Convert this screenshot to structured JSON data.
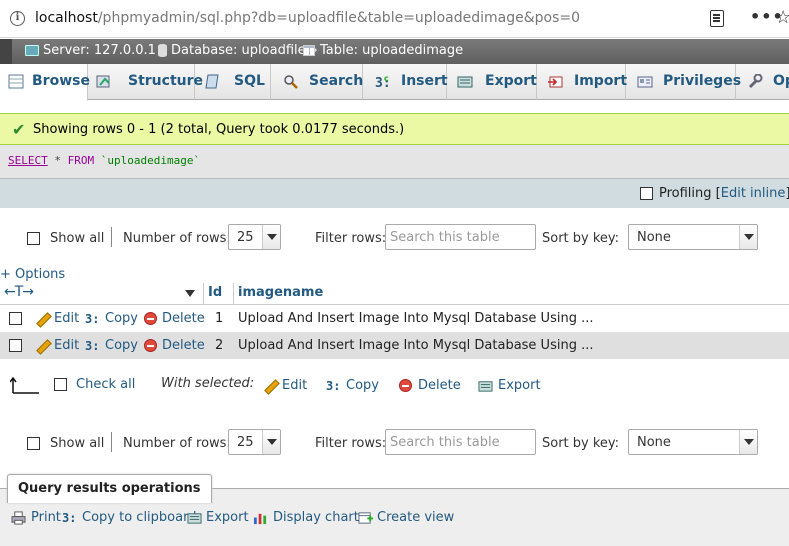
{
  "browser": {
    "url_host": "localhost",
    "url_path": "/phpmyadmin/sql.php?db=uploadfile&table=uploadedimage&pos=0",
    "dots": "•••",
    "star": "☆"
  },
  "breadcrumb": {
    "server": "Server: 127.0.0.1 »",
    "database": "Database: uploadfile »",
    "table": "Table: uploadedimage"
  },
  "tabs": [
    {
      "label": "Browse",
      "icon": "browse-icon",
      "active": true
    },
    {
      "label": "Structure",
      "icon": "structure-icon"
    },
    {
      "label": "SQL",
      "icon": "sql-icon"
    },
    {
      "label": "Search",
      "icon": "search-icon"
    },
    {
      "label": "Insert",
      "icon": "insert-icon"
    },
    {
      "label": "Export",
      "icon": "export-icon"
    },
    {
      "label": "Import",
      "icon": "import-icon"
    },
    {
      "label": "Privileges",
      "icon": "privileges-icon"
    },
    {
      "label": "Op",
      "icon": "operations-icon"
    }
  ],
  "success_message": "Showing rows 0 - 1 (2 total, Query took 0.0177 seconds.)",
  "sql": {
    "select": "SELECT",
    "star": "*",
    "from": "FROM",
    "table": "`uploadedimage`"
  },
  "profiling": {
    "label": "Profiling",
    "open": "[",
    "edit_inline": "Edit inline",
    "close": "] [",
    "edit": "E"
  },
  "nav": {
    "show_all": "Show all",
    "number_of_rows_label": "Number of rows:",
    "number_of_rows_value": "25",
    "filter_rows_label": "Filter rows:",
    "filter_placeholder": "Search this table",
    "sort_by_key_label": "Sort by key:",
    "sort_by_key_value": "None"
  },
  "options_link": "+ Options",
  "columns": {
    "arrows": "←T→",
    "id": "Id",
    "imagename": "imagename"
  },
  "rows": [
    {
      "edit": "Edit",
      "copy": "Copy",
      "delete": "Delete",
      "id": "1",
      "imagename": "Upload And Insert Image Into Mysql Database Using ..."
    },
    {
      "edit": "Edit",
      "copy": "Copy",
      "delete": "Delete",
      "id": "2",
      "imagename": "Upload And Insert Image Into Mysql Database Using ..."
    }
  ],
  "bulk": {
    "check_all": "Check all",
    "with_selected": "With selected:",
    "edit": "Edit",
    "copy": "Copy",
    "delete": "Delete",
    "export": "Export"
  },
  "query_ops": {
    "legend": "Query results operations",
    "print": "Print",
    "copy_to_clipboard": "Copy to clipboard",
    "export": "Export",
    "display_chart": "Display chart",
    "create_view": "Create view"
  },
  "colors": {
    "link": "#235a81",
    "success_bg": "#ebf8a4",
    "row_alt": "#dfdfdf",
    "breadcrumb_bg": "#6c6c6c"
  }
}
